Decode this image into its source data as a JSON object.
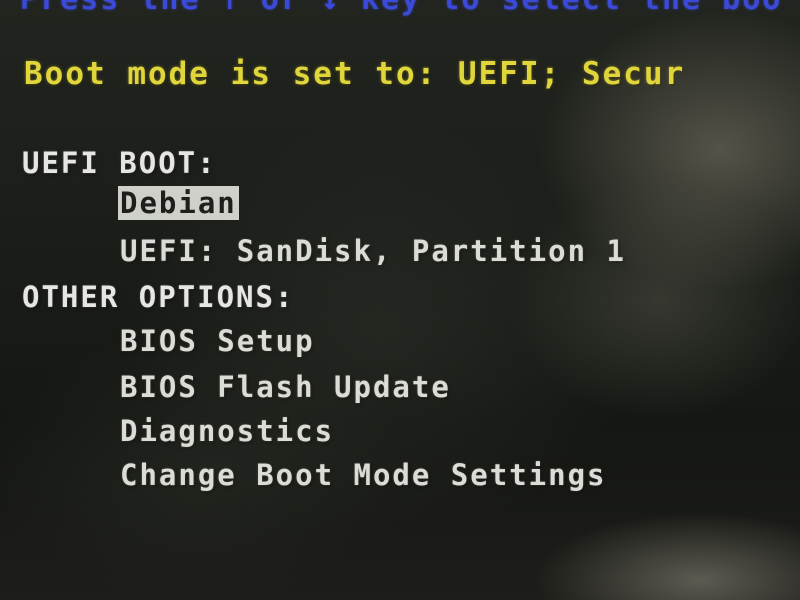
{
  "screen": {
    "partial_top_line": "Press the ↑ or ↓ key to select the boo",
    "boot_mode_line": "Boot mode is set to: UEFI; Secur",
    "colors": {
      "background": "#141612",
      "top_line": "#3b4ad8",
      "boot_mode_text": "#e0d63c",
      "menu_text": "#dcdcd6",
      "selection_highlight": "#d0d0ca"
    }
  },
  "uefi_boot": {
    "header": "UEFI BOOT:",
    "items": [
      {
        "label": "Debian",
        "selected": true
      },
      {
        "label": "UEFI: SanDisk, Partition 1",
        "selected": false
      }
    ]
  },
  "other_options": {
    "header": "OTHER OPTIONS:",
    "items": [
      {
        "label": "BIOS Setup"
      },
      {
        "label": "BIOS Flash Update"
      },
      {
        "label": "Diagnostics"
      },
      {
        "label": "Change Boot Mode Settings"
      }
    ]
  }
}
